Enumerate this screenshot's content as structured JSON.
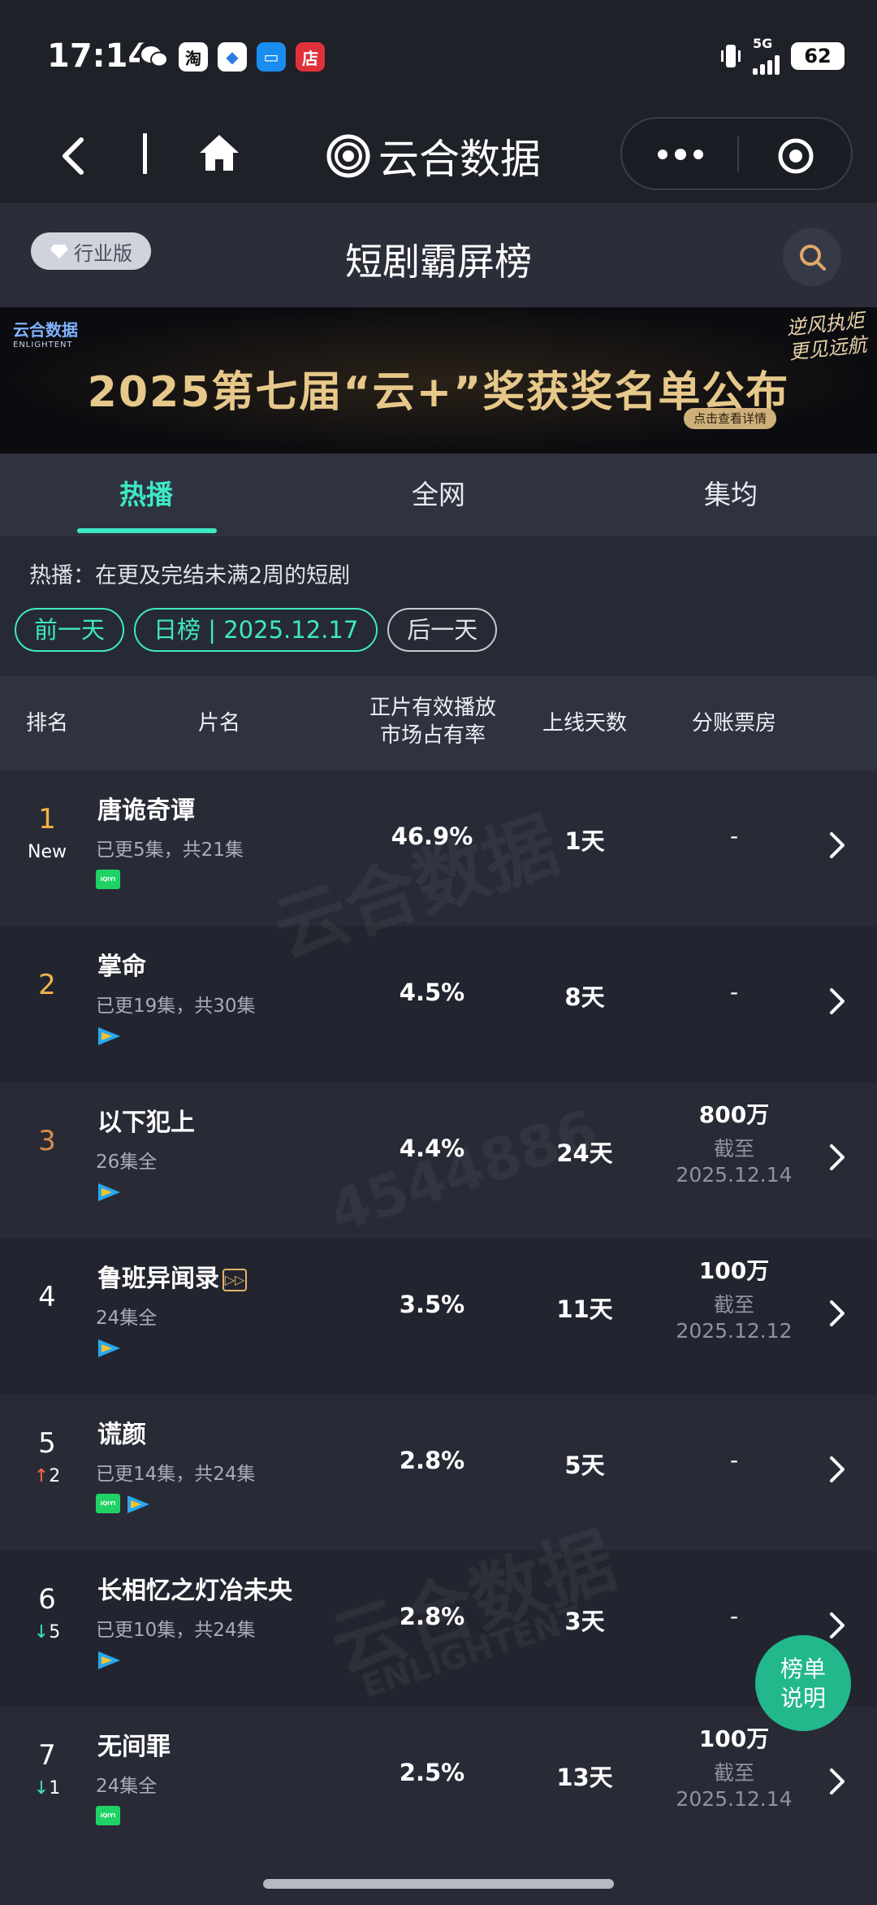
{
  "status": {
    "time": "17:14",
    "apps": [
      {
        "icon": "wechat-icon",
        "glyph": "",
        "bg": "#1f2129",
        "fg": "#ffffff"
      },
      {
        "icon": "taobao-icon",
        "glyph": "淘",
        "bg": "#ffffff",
        "fg": "#111111"
      },
      {
        "icon": "app-bird-icon",
        "glyph": "◆",
        "bg": "#ffffff",
        "fg": "#2a7de1"
      },
      {
        "icon": "app-message-icon",
        "glyph": "▭",
        "bg": "#1a8df0",
        "fg": "#ffffff"
      },
      {
        "icon": "store-icon",
        "glyph": "店",
        "bg": "#e0313b",
        "fg": "#ffffff"
      }
    ],
    "network": "5G",
    "battery": "62"
  },
  "nav": {
    "title": "云合数据"
  },
  "header": {
    "edition": "行业版",
    "title": "短剧霸屏榜"
  },
  "banner": {
    "logo": "云合数据",
    "logo_en": "ENLIGHTENT",
    "title": "2025第七届“云+”奖获奖名单公布",
    "slogan_line1": "逆风执炬",
    "slogan_line2": "更见远航",
    "cta": "点击查看详情"
  },
  "tabs": [
    {
      "label": "热播",
      "active": true
    },
    {
      "label": "全网",
      "active": false
    },
    {
      "label": "集均",
      "active": false
    }
  ],
  "description": "热播：在更及完结未满2周的短剧",
  "date_nav": {
    "prev": "前一天",
    "current": "日榜 | 2025.12.17",
    "next": "后一天"
  },
  "columns": {
    "rank": "排名",
    "title": "片名",
    "share_line1": "正片有效播放",
    "share_line2": "市场占有率",
    "days": "上线天数",
    "box_office": "分账票房"
  },
  "rows": [
    {
      "rank": "1",
      "change": "New",
      "title": "唐诡奇谭",
      "status": "已更5集，共21集",
      "share": "46.9%",
      "days": "1天",
      "box": "-",
      "box_note": ""
    },
    {
      "rank": "2",
      "change": "",
      "title": "掌命",
      "status": "已更19集，共30集",
      "share": "4.5%",
      "days": "8天",
      "box": "-",
      "box_note": ""
    },
    {
      "rank": "3",
      "change": "",
      "title": "以下犯上",
      "status": "26集全",
      "share": "4.4%",
      "days": "24天",
      "box": "800万",
      "box_note_1": "截至",
      "box_note_2": "2025.12.14"
    },
    {
      "rank": "4",
      "change": "",
      "title": "鲁班异闻录",
      "status": "24集全",
      "share": "3.5%",
      "days": "11天",
      "box": "100万",
      "box_note_1": "截至",
      "box_note_2": "2025.12.12"
    },
    {
      "rank": "5",
      "change": "2",
      "title": "谎颜",
      "status": "已更14集，共24集",
      "share": "2.8%",
      "days": "5天",
      "box": "-",
      "box_note": ""
    },
    {
      "rank": "6",
      "change": "5",
      "title": "长相忆之灯冶未央",
      "status": "已更10集，共24集",
      "share": "2.8%",
      "days": "3天",
      "box": "-",
      "box_note": ""
    },
    {
      "rank": "7",
      "change": "1",
      "title": "无间罪",
      "status": "24集全",
      "share": "2.5%",
      "days": "13天",
      "box": "100万",
      "box_note_1": "截至",
      "box_note_2": "2025.12.14"
    }
  ],
  "platform": {
    "iqiyi": "iQIYI"
  },
  "float_button": {
    "line1": "榜单",
    "line2": "说明"
  },
  "watermark": {
    "brand": "云合数据",
    "brand_en": "ENLIGHTENT",
    "id": "4544886"
  },
  "colors": {
    "accent": "#3ee8c4",
    "rank_gold": "#f0b44a",
    "rank_bronze": "#d98a4a",
    "up": "#ff6a4a",
    "down": "#3ee8c4",
    "iqiyi": "#1fd266",
    "tencent": "#28a8f0"
  }
}
